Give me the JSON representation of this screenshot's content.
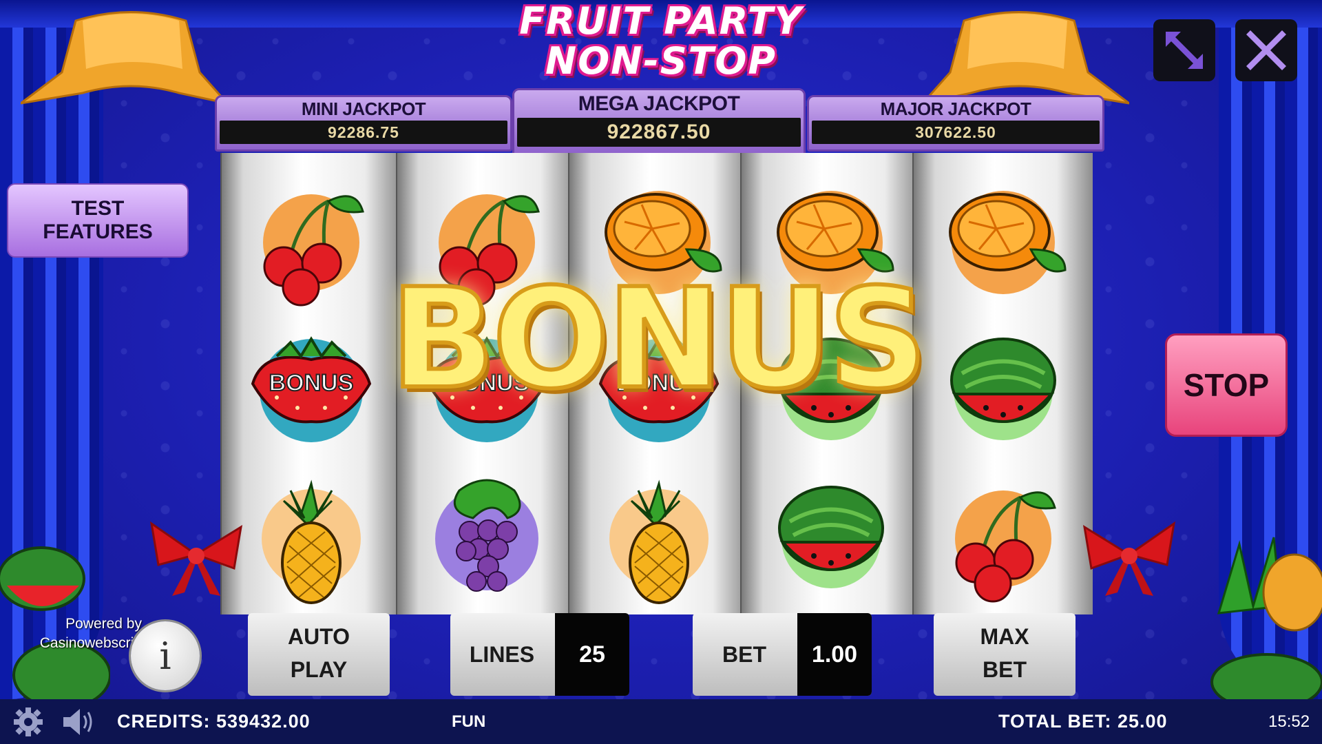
{
  "game": {
    "title_line1": "FRUIT PARTY",
    "title_line2": "NON-STOP"
  },
  "jackpots": {
    "mini": {
      "label": "MINI JACKPOT",
      "value": "92286.75"
    },
    "mega": {
      "label": "MEGA JACKPOT",
      "value": "922867.50"
    },
    "major": {
      "label": "MAJOR JACKPOT",
      "value": "307622.50"
    }
  },
  "buttons": {
    "test_features_1": "TEST",
    "test_features_2": "FEATURES",
    "stop": "STOP",
    "autoplay_1": "AUTO",
    "autoplay_2": "PLAY",
    "maxbet_1": "MAX",
    "maxbet_2": "BET",
    "info": "i"
  },
  "controls": {
    "lines_label": "LINES",
    "lines_value": "25",
    "bet_label": "BET",
    "bet_value": "1.00"
  },
  "reels": [
    [
      "cherry",
      "strawberry-bonus",
      "pineapple"
    ],
    [
      "cherry",
      "strawberry-bonus",
      "grapes"
    ],
    [
      "orange",
      "strawberry-bonus",
      "pineapple"
    ],
    [
      "orange",
      "watermelon",
      "watermelon"
    ],
    [
      "orange",
      "watermelon",
      "cherry"
    ]
  ],
  "bonus_symbol_label": "BONUS",
  "overlay": {
    "bonus_text": "BONUS"
  },
  "powered_by": {
    "line1": "Powered by",
    "line2": "Casinowebscrip"
  },
  "status_bar": {
    "credits": "CREDITS: 539432.00",
    "mode": "FUN",
    "total_bet": "TOTAL BET: 25.00",
    "clock": "15:52"
  },
  "colors": {
    "background": "#1c1fb0",
    "jackpot_purple": "#8e62cc",
    "stop_pink": "#e8447c",
    "status_bar": "#0d1450"
  },
  "icons": [
    "fullscreen-icon",
    "close-icon",
    "gear-icon",
    "speaker-icon",
    "info-icon"
  ]
}
